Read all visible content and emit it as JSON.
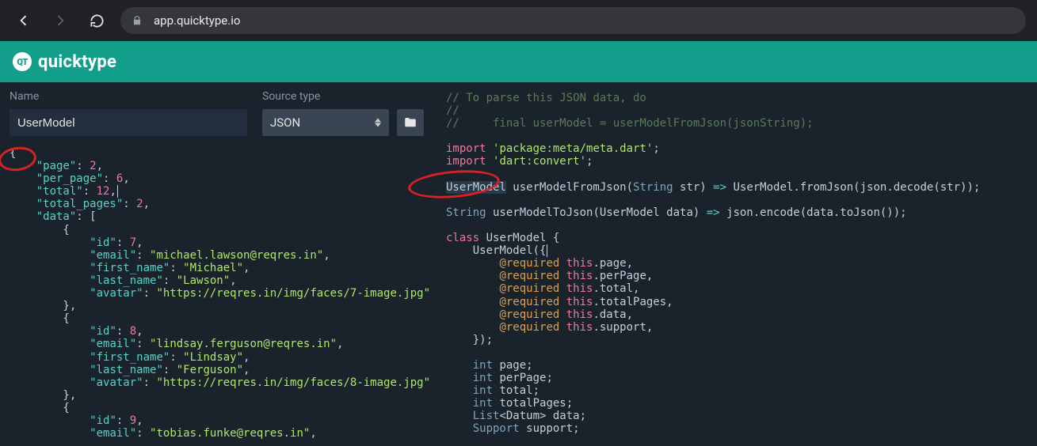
{
  "browser": {
    "url": "app.quicktype.io"
  },
  "header": {
    "badge": "QT",
    "brand": "quicktype"
  },
  "left": {
    "name_label": "Name",
    "name_value": "UserModel",
    "source_label": "Source type",
    "source_value": "JSON",
    "json": {
      "page": 2,
      "per_page": 6,
      "total": 12,
      "total_pages": 2,
      "data": [
        {
          "id": 7,
          "email": "michael.lawson@reqres.in",
          "first_name": "Michael",
          "last_name": "Lawson",
          "avatar": "https://reqres.in/img/faces/7-image.jpg"
        },
        {
          "id": 8,
          "email": "lindsay.ferguson@reqres.in",
          "first_name": "Lindsay",
          "last_name": "Ferguson",
          "avatar": "https://reqres.in/img/faces/8-image.jpg"
        },
        {
          "id": 9,
          "email": "tobias.funke@reqres.in"
        }
      ]
    }
  },
  "right": {
    "lines": [
      {
        "t": "cmt",
        "s": "// To parse this JSON data, do"
      },
      {
        "t": "cmt",
        "s": "//"
      },
      {
        "t": "cmt",
        "s": "//     final userModel = userModelFromJson(jsonString);"
      },
      {
        "t": "blank"
      },
      {
        "t": "import",
        "pkg": "package:meta/meta.dart"
      },
      {
        "t": "import",
        "pkg": "dart:convert"
      },
      {
        "t": "blank"
      },
      {
        "t": "fromJson"
      },
      {
        "t": "blank"
      },
      {
        "t": "toJson"
      },
      {
        "t": "blank"
      },
      {
        "t": "class-open"
      },
      {
        "t": "ctor-open"
      },
      {
        "t": "req",
        "f": "page"
      },
      {
        "t": "req",
        "f": "perPage"
      },
      {
        "t": "req",
        "f": "total"
      },
      {
        "t": "req",
        "f": "totalPages"
      },
      {
        "t": "req",
        "f": "data"
      },
      {
        "t": "req",
        "f": "support"
      },
      {
        "t": "ctor-close"
      },
      {
        "t": "blank"
      },
      {
        "t": "field",
        "ty": "int",
        "n": "page"
      },
      {
        "t": "field",
        "ty": "int",
        "n": "perPage"
      },
      {
        "t": "field",
        "ty": "int",
        "n": "total"
      },
      {
        "t": "field",
        "ty": "int",
        "n": "totalPages"
      },
      {
        "t": "field-generic",
        "ty": "List",
        "g": "Datum",
        "n": "data"
      },
      {
        "t": "field",
        "ty": "Support",
        "n": "support"
      }
    ]
  }
}
